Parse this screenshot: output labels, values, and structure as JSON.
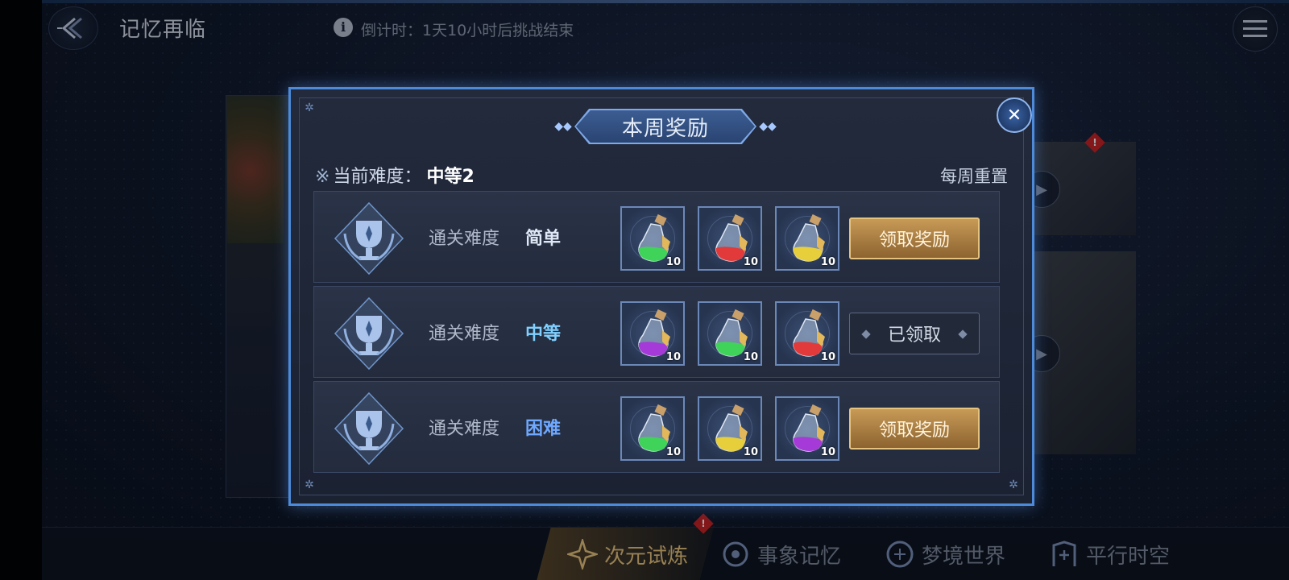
{
  "header": {
    "title": "记忆再临",
    "countdown": "倒计时：1天10小时后挑战结束",
    "info_icon": "i"
  },
  "bottom_nav": [
    {
      "label": "次元试炼",
      "icon": "star-compass-icon",
      "active": true
    },
    {
      "label": "事象记忆",
      "icon": "swirl-icon",
      "active": false
    },
    {
      "label": "梦境世界",
      "icon": "dreamcatcher-icon",
      "active": false
    },
    {
      "label": "平行时空",
      "icon": "gate-icon",
      "active": false
    }
  ],
  "dialog": {
    "title": "本周奖励",
    "current_difficulty_label": "当前难度：",
    "current_difficulty_value": "中等2",
    "reset_text": "每周重置",
    "rows": [
      {
        "label": "通关难度",
        "level": "简单",
        "level_color": "#dfe8f5",
        "items": [
          {
            "potion": "green",
            "color": "#3fd35a",
            "qty": "10"
          },
          {
            "potion": "red",
            "color": "#e23a3a",
            "qty": "10"
          },
          {
            "potion": "yellow",
            "color": "#e6cf3a",
            "qty": "10"
          }
        ],
        "button": {
          "label": "领取奖励",
          "state": "claimable"
        }
      },
      {
        "label": "通关难度",
        "level": "中等",
        "level_color": "#7fd0ff",
        "items": [
          {
            "potion": "purple",
            "color": "#a53ad8",
            "qty": "10"
          },
          {
            "potion": "green",
            "color": "#3fd35a",
            "qty": "10"
          },
          {
            "potion": "red",
            "color": "#e23a3a",
            "qty": "10"
          }
        ],
        "button": {
          "label": "已领取",
          "state": "claimed"
        }
      },
      {
        "label": "通关难度",
        "level": "困难",
        "level_color": "#6fa8ff",
        "items": [
          {
            "potion": "green",
            "color": "#3fd35a",
            "qty": "10"
          },
          {
            "potion": "yellow",
            "color": "#e6cf3a",
            "qty": "10"
          },
          {
            "potion": "purple",
            "color": "#a53ad8",
            "qty": "10"
          }
        ],
        "button": {
          "label": "领取奖励",
          "state": "claimable"
        }
      }
    ]
  },
  "colors": {
    "accent_blue": "#4d8ad9",
    "claim_gold": "#c79a56",
    "alert_red": "#c82121",
    "nav_active": "#e8c37a"
  }
}
